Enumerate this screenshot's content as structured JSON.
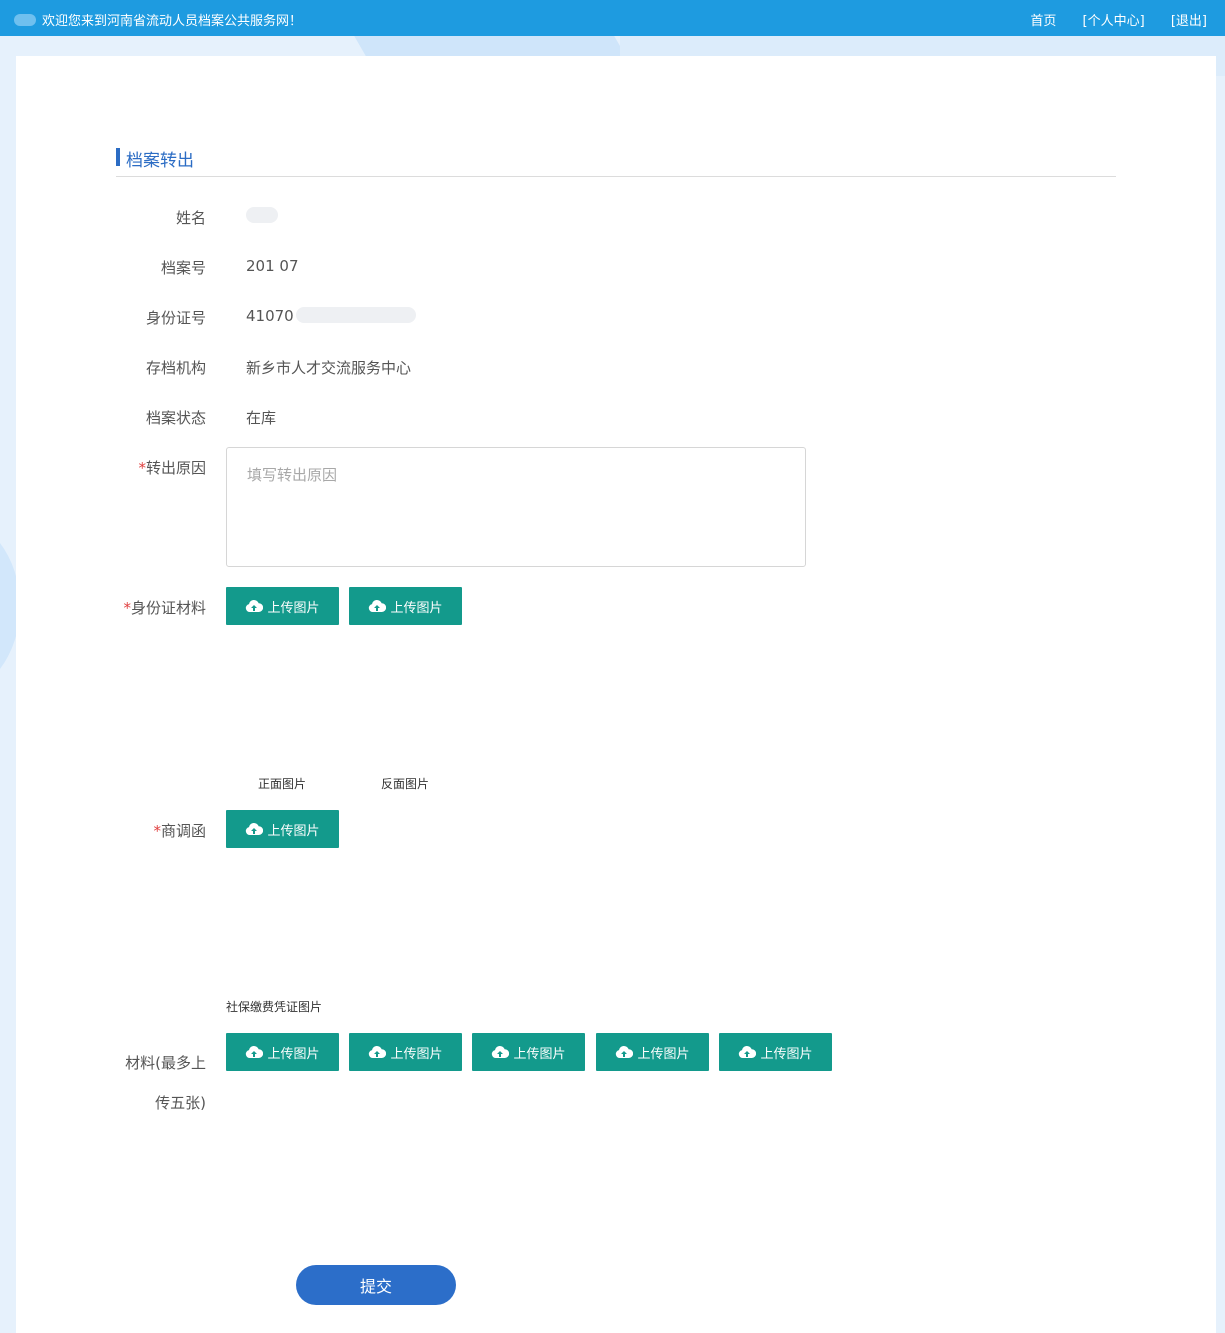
{
  "topbar": {
    "welcome": "欢迎您来到河南省流动人员档案公共服务网！",
    "nav": [
      "首页",
      "[个人中心]",
      "[退出]"
    ]
  },
  "section": {
    "title": "档案转出"
  },
  "info": [
    {
      "label": "姓名",
      "value": ""
    },
    {
      "label": "档案号",
      "value": "201    07"
    },
    {
      "label": "身份证号",
      "value": "41070"
    },
    {
      "label": "存档机构",
      "value": "新乡市人才交流服务中心"
    },
    {
      "label": "档案状态",
      "value": "在库"
    }
  ],
  "reason": {
    "label": "转出原因",
    "required": "*",
    "placeholder": "填写转出原因"
  },
  "id_material": {
    "label": "身份证材料",
    "required": "*",
    "button_label": "上传图片",
    "captions": [
      "正面图片",
      "反面图片"
    ]
  },
  "letter": {
    "label": "商调函",
    "required": "*",
    "button_label": "上传图片",
    "caption": "社保缴费凭证图片"
  },
  "materials": {
    "label_line1": "材料(最多上",
    "label_line2": "传五张)",
    "button_label": "上传图片",
    "count": 5
  },
  "submit": {
    "label": "提交"
  },
  "colors": {
    "topbar": "#1e9be0",
    "title": "#2b6cc4",
    "upload_button": "#139a8c",
    "submit_button": "#2c6ec9",
    "required": "#e04040"
  }
}
